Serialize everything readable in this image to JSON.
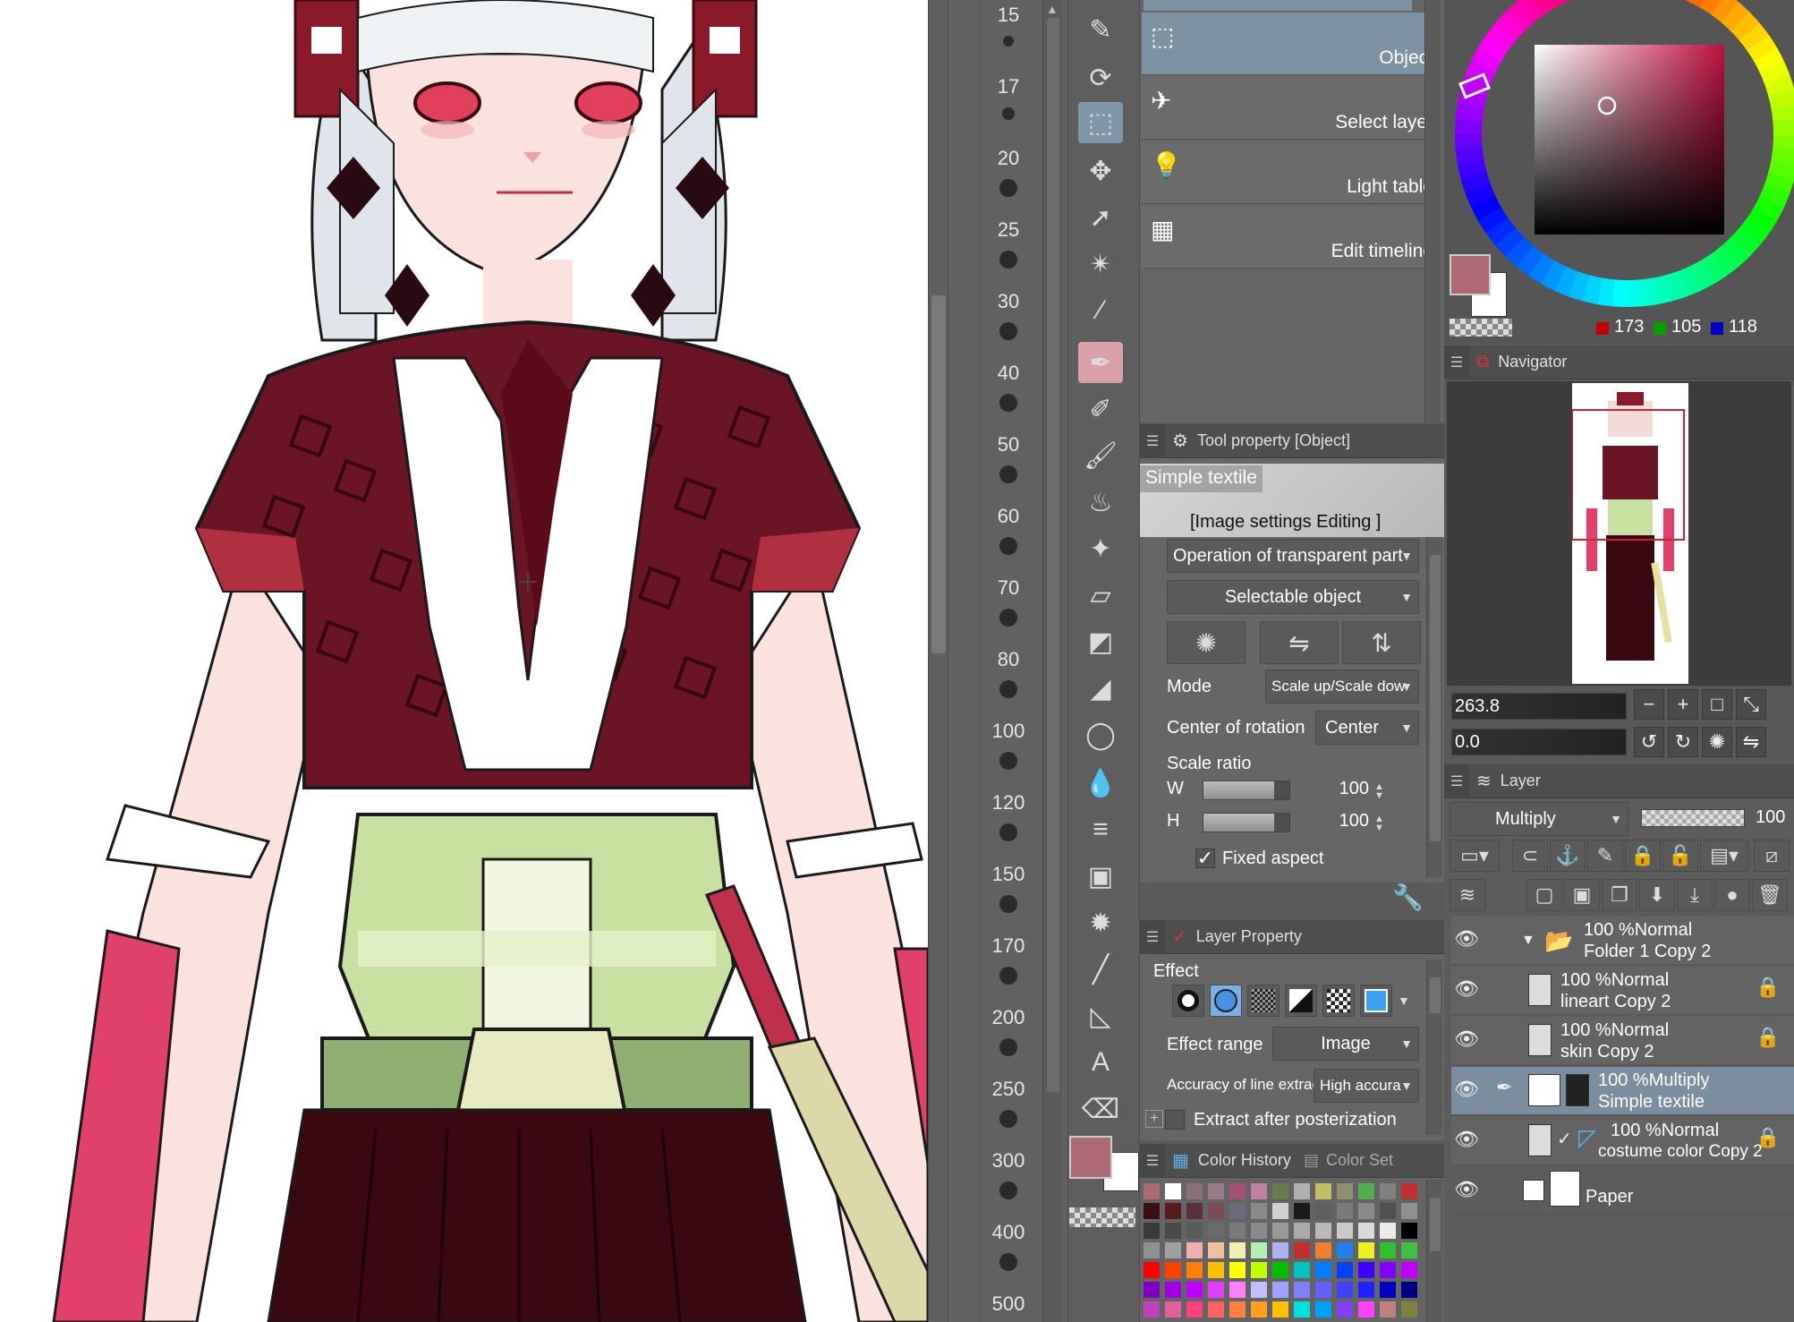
{
  "brush_sizes": [
    "15",
    "17",
    "20",
    "25",
    "30",
    "40",
    "50",
    "60",
    "70",
    "80",
    "100",
    "120",
    "150",
    "170",
    "200",
    "250",
    "300",
    "400",
    "500"
  ],
  "subtools": [
    {
      "label": "Object",
      "icon": "object-select-icon",
      "selected": true
    },
    {
      "label": "Select layer",
      "icon": "select-layer-icon",
      "selected": false
    },
    {
      "label": "Light table",
      "icon": "light-table-icon",
      "selected": false
    },
    {
      "label": "Edit timeline",
      "icon": "edit-timeline-icon",
      "selected": false
    }
  ],
  "tool_property": {
    "header": "Tool property [Object]",
    "preset_name": "Simple textile",
    "preset_sub": "[Image settings Editing ]",
    "transparent_op": "Operation of transparent part",
    "selectable": "Selectable object",
    "mode_label": "Mode",
    "mode_value": "Scale up/Scale dow",
    "rotation_label": "Center of rotation",
    "rotation_value": "Center",
    "scale_label": "Scale ratio",
    "w_label": "W",
    "w_value": "100",
    "h_label": "H",
    "h_value": "100",
    "fixed_aspect": "Fixed aspect"
  },
  "layer_property": {
    "header": "Layer Property",
    "effect_label": "Effect",
    "effect_range_label": "Effect range",
    "effect_range_value": "Image",
    "accuracy_label": "Accuracy of line extrac",
    "accuracy_value": "High accura",
    "extract_label": "Extract after posterization"
  },
  "color_panel": {
    "history_tab": "Color History",
    "set_tab": "Color Set",
    "main_color": "#ad6976",
    "r": "173",
    "g": "105",
    "b": "118",
    "history_swatches": [
      "#ad6976",
      "#ffffff",
      "#8a6f7a",
      "#9a7a86",
      "#a55070",
      "#c080a0",
      "#6a7a4a",
      "#b0b0b0",
      "#c0c060",
      "#909070",
      "#50b050",
      "#808080",
      "#c03030",
      "#3a1010",
      "#5a1a1a",
      "#5a3040",
      "#7a4a5a",
      "#6a6a7a",
      "#8a8a8a",
      "#d0d0d0",
      "#1a1a1a",
      "#606060",
      "#7a7a7a",
      "#8a8a8a",
      "#505050",
      "#909090"
    ],
    "palette_rows": [
      [
        "#3a3a3a",
        "#4a4a4a",
        "#5a5a5a",
        "#6a6a6a",
        "#7a7a7a",
        "#8a8a8a",
        "#9a9a9a",
        "#aaaaaa",
        "#bababa",
        "#cacaca",
        "#dadada",
        "#eaeaea",
        "#000000"
      ],
      [
        "#909090",
        "#a0a0a0",
        "#f0b0b0",
        "#f0c0a0",
        "#f0f0b0",
        "#b0f0b0",
        "#b0b0f0",
        "#c03030",
        "#f08030",
        "#2080f0",
        "#f0f020",
        "#30c030",
        "#40c040"
      ],
      [
        "#ff0000",
        "#ff4000",
        "#ff8000",
        "#ffc000",
        "#ffff00",
        "#c0ff00",
        "#00c000",
        "#00c0c0",
        "#0080ff",
        "#0040ff",
        "#4000ff",
        "#8000ff",
        "#c000ff"
      ],
      [
        "#8000c0",
        "#a000e0",
        "#c000ff",
        "#e040ff",
        "#ff80ff",
        "#c0c0ff",
        "#a0a0ff",
        "#8080ff",
        "#6060ff",
        "#4040ff",
        "#2020ff",
        "#0000c0",
        "#000080"
      ],
      [
        "#c040c0",
        "#e060a0",
        "#ff4080",
        "#ff6060",
        "#ff8040",
        "#ffa020",
        "#ffc000",
        "#00e0e0",
        "#00a0ff",
        "#8040ff",
        "#ff40ff",
        "#c08080",
        "#808040"
      ]
    ]
  },
  "navigator": {
    "title": "Navigator",
    "zoom": "263.8",
    "rotation": "0.0"
  },
  "layer_panel": {
    "title": "Layer",
    "blend_mode": "Multiply",
    "opacity": "100",
    "layers": [
      {
        "line1": "100 %Normal",
        "line2": "Folder 1 Copy 2",
        "type": "folder",
        "selected": false
      },
      {
        "line1": "100 %Normal",
        "line2": "lineart Copy 2",
        "type": "raster",
        "selected": false
      },
      {
        "line1": "100 %Normal",
        "line2": "skin Copy 2",
        "type": "raster",
        "selected": false
      },
      {
        "line1": "100 %Multiply",
        "line2": "Simple textile",
        "type": "image",
        "selected": true
      },
      {
        "line1": "100 %Normal",
        "line2": "costume color Copy 2",
        "type": "raster",
        "selected": false
      },
      {
        "line1": "",
        "line2": "Paper",
        "type": "paper",
        "selected": false
      }
    ]
  },
  "colors": {
    "panel_bg": "#666666",
    "selection_blue": "#7d93a4",
    "artwork_maroon": "#6a1525",
    "artwork_green": "#c8e0a0"
  }
}
